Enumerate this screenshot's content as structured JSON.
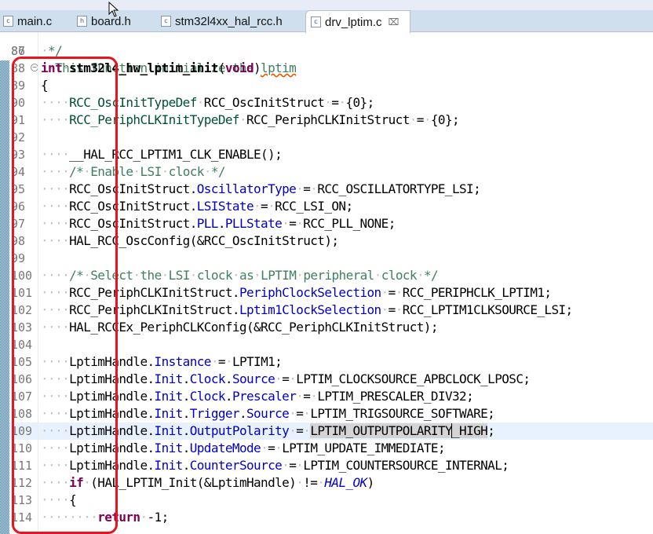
{
  "tabs": [
    {
      "label": "main.c",
      "icon": "c-file-icon",
      "icon_glyph": "c",
      "active": false
    },
    {
      "label": "board.h",
      "icon": "h-file-icon",
      "icon_glyph": "h",
      "active": false
    },
    {
      "label": "stm32l4xx_hal_rcc.h",
      "icon": "c-file-icon",
      "icon_glyph": "c",
      "active": false
    },
    {
      "label": "drv_lptim.c",
      "icon": "c-file-icon",
      "icon_glyph": "c",
      "active": true,
      "close_glyph": "⌧"
    }
  ],
  "editor": {
    "partial_line": {
      "number": "86",
      "text": "  This function initialize the lptim"
    },
    "lines": [
      {
        "number": "87",
        "text": " */"
      },
      {
        "number": "88",
        "text": "int stm32l4_hw_lptim_init(void)"
      },
      {
        "number": "89",
        "text": "{"
      },
      {
        "number": "90",
        "text": "    RCC_OscInitTypeDef RCC_OscInitStruct = {0};"
      },
      {
        "number": "91",
        "text": "    RCC_PeriphCLKInitTypeDef RCC_PeriphCLKInitStruct = {0};"
      },
      {
        "number": "92",
        "text": ""
      },
      {
        "number": "93",
        "text": "    __HAL_RCC_LPTIM1_CLK_ENABLE();"
      },
      {
        "number": "94",
        "text": "    /* Enable LSI clock */"
      },
      {
        "number": "95",
        "text": "    RCC_OscInitStruct.OscillatorType = RCC_OSCILLATORTYPE_LSI;"
      },
      {
        "number": "96",
        "text": "    RCC_OscInitStruct.LSIState = RCC_LSI_ON;"
      },
      {
        "number": "97",
        "text": "    RCC_OscInitStruct.PLL.PLLState = RCC_PLL_NONE;"
      },
      {
        "number": "98",
        "text": "    HAL_RCC_OscConfig(&RCC_OscInitStruct);"
      },
      {
        "number": "99",
        "text": ""
      },
      {
        "number": "100",
        "text": "    /* Select the LSI clock as LPTIM peripheral clock */"
      },
      {
        "number": "101",
        "text": "    RCC_PeriphCLKInitStruct.PeriphClockSelection = RCC_PERIPHCLK_LPTIM1;"
      },
      {
        "number": "102",
        "text": "    RCC_PeriphCLKInitStruct.Lptim1ClockSelection = RCC_LPTIM1CLKSOURCE_LSI;"
      },
      {
        "number": "103",
        "text": "    HAL_RCCEx_PeriphCLKConfig(&RCC_PeriphCLKInitStruct);"
      },
      {
        "number": "104",
        "text": ""
      },
      {
        "number": "105",
        "text": "    LptimHandle.Instance = LPTIM1;"
      },
      {
        "number": "106",
        "text": "    LptimHandle.Init.Clock.Source = LPTIM_CLOCKSOURCE_APBCLOCK_LPOSC;"
      },
      {
        "number": "107",
        "text": "    LptimHandle.Init.Clock.Prescaler = LPTIM_PRESCALER_DIV32;"
      },
      {
        "number": "108",
        "text": "    LptimHandle.Init.Trigger.Source = LPTIM_TRIGSOURCE_SOFTWARE;"
      },
      {
        "number": "109",
        "text": "    LptimHandle.Init.OutputPolarity = LPTIM_OUTPUTPOLARITY_HIGH;"
      },
      {
        "number": "110",
        "text": "    LptimHandle.Init.UpdateMode = LPTIM_UPDATE_IMMEDIATE;"
      },
      {
        "number": "111",
        "text": "    LptimHandle.Init.CounterSource = LPTIM_COUNTERSOURCE_INTERNAL;"
      },
      {
        "number": "112",
        "text": "    if (HAL_LPTIM_Init(&LptimHandle) != HAL_OK)"
      },
      {
        "number": "113",
        "text": "    {"
      },
      {
        "number": "114",
        "text": "        return -1;"
      }
    ],
    "current_line": "109",
    "selected_text": "LPTIM_OUTPUTPOLARITY_HIGH",
    "fold_line": "88"
  },
  "annotation": {
    "type": "highlight-box",
    "color": "#e8141e",
    "covers": "line-number-gutter 88-114"
  },
  "colors": {
    "keyword": "#7f0055",
    "type": "#005032",
    "field": "#0000c0",
    "comment": "#3f7f5f",
    "current_line_bg": "#e8f2fe",
    "selection_bg": "#d4d4d4",
    "tabbar_bg": "#d0dfee"
  }
}
